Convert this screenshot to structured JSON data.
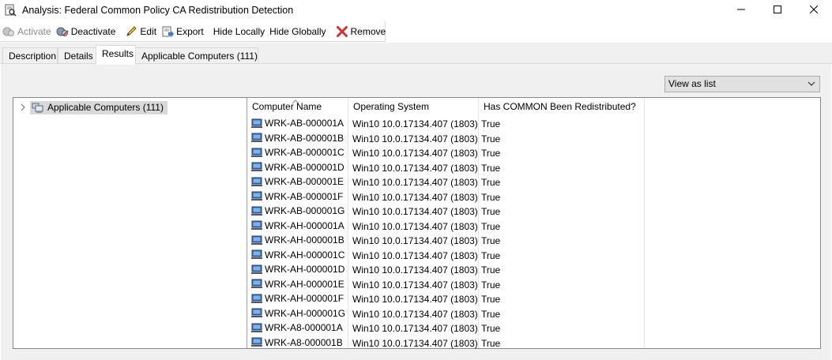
{
  "window": {
    "title": "Analysis: Federal Common Policy CA Redistribution Detection",
    "controls": [
      "minimize",
      "maximize",
      "close"
    ]
  },
  "toolbar": {
    "activate_label": "Activate",
    "deactivate_label": "Deactivate",
    "edit_label": "Edit",
    "export_label": "Export",
    "hide_locally_label": "Hide Locally",
    "hide_globally_label": "Hide Globally",
    "remove_label": "Remove"
  },
  "tabs": [
    {
      "label": "Description"
    },
    {
      "label": "Details"
    },
    {
      "label": "Results"
    },
    {
      "label": "Applicable Computers (111)"
    }
  ],
  "view_select": {
    "value": "View as list"
  },
  "tree": {
    "root_label": "Applicable Computers (111)"
  },
  "grid": {
    "columns": [
      "Computer Name",
      "Operating System",
      "Has COMMON Been Redistributed?"
    ],
    "rows": [
      {
        "name": "WRK-AB-000001A",
        "os": "Win10 10.0.17134.407 (1803)",
        "has": "True"
      },
      {
        "name": "WRK-AB-000001B",
        "os": "Win10 10.0.17134.407 (1803)",
        "has": "True"
      },
      {
        "name": "WRK-AB-000001C",
        "os": "Win10 10.0.17134.407 (1803)",
        "has": "True"
      },
      {
        "name": "WRK-AB-000001D",
        "os": "Win10 10.0.17134.407 (1803)",
        "has": "True"
      },
      {
        "name": "WRK-AB-000001E",
        "os": "Win10 10.0.17134.407 (1803)",
        "has": "True"
      },
      {
        "name": "WRK-AB-000001F",
        "os": "Win10 10.0.17134.407 (1803)",
        "has": "True"
      },
      {
        "name": "WRK-AB-000001G",
        "os": "Win10 10.0.17134.407 (1803)",
        "has": "True"
      },
      {
        "name": "WRK-AH-000001A",
        "os": "Win10 10.0.17134.407 (1803)",
        "has": "True"
      },
      {
        "name": "WRK-AH-000001B",
        "os": "Win10 10.0.17134.407 (1803)",
        "has": "True"
      },
      {
        "name": "WRK-AH-000001C",
        "os": "Win10 10.0.17134.407 (1803)",
        "has": "True"
      },
      {
        "name": "WRK-AH-000001D",
        "os": "Win10 10.0.17134.407 (1803)",
        "has": "True"
      },
      {
        "name": "WRK-AH-000001E",
        "os": "Win10 10.0.17134.407 (1803)",
        "has": "True"
      },
      {
        "name": "WRK-AH-000001F",
        "os": "Win10 10.0.17134.407 (1803)",
        "has": "True"
      },
      {
        "name": "WRK-AH-000001G",
        "os": "Win10 10.0.17134.407 (1803)",
        "has": "True"
      },
      {
        "name": "WRK-A8-000001A",
        "os": "Win10 10.0.17134.407 (1803)",
        "has": "True"
      },
      {
        "name": "WRK-A8-000001B",
        "os": "Win10 10.0.17134.407 (1803)",
        "has": "True"
      }
    ]
  },
  "colors": {
    "remove_icon": "#d9302c",
    "tree_selection": "#d9d9d9",
    "panel_background": "#f0f0f0"
  }
}
